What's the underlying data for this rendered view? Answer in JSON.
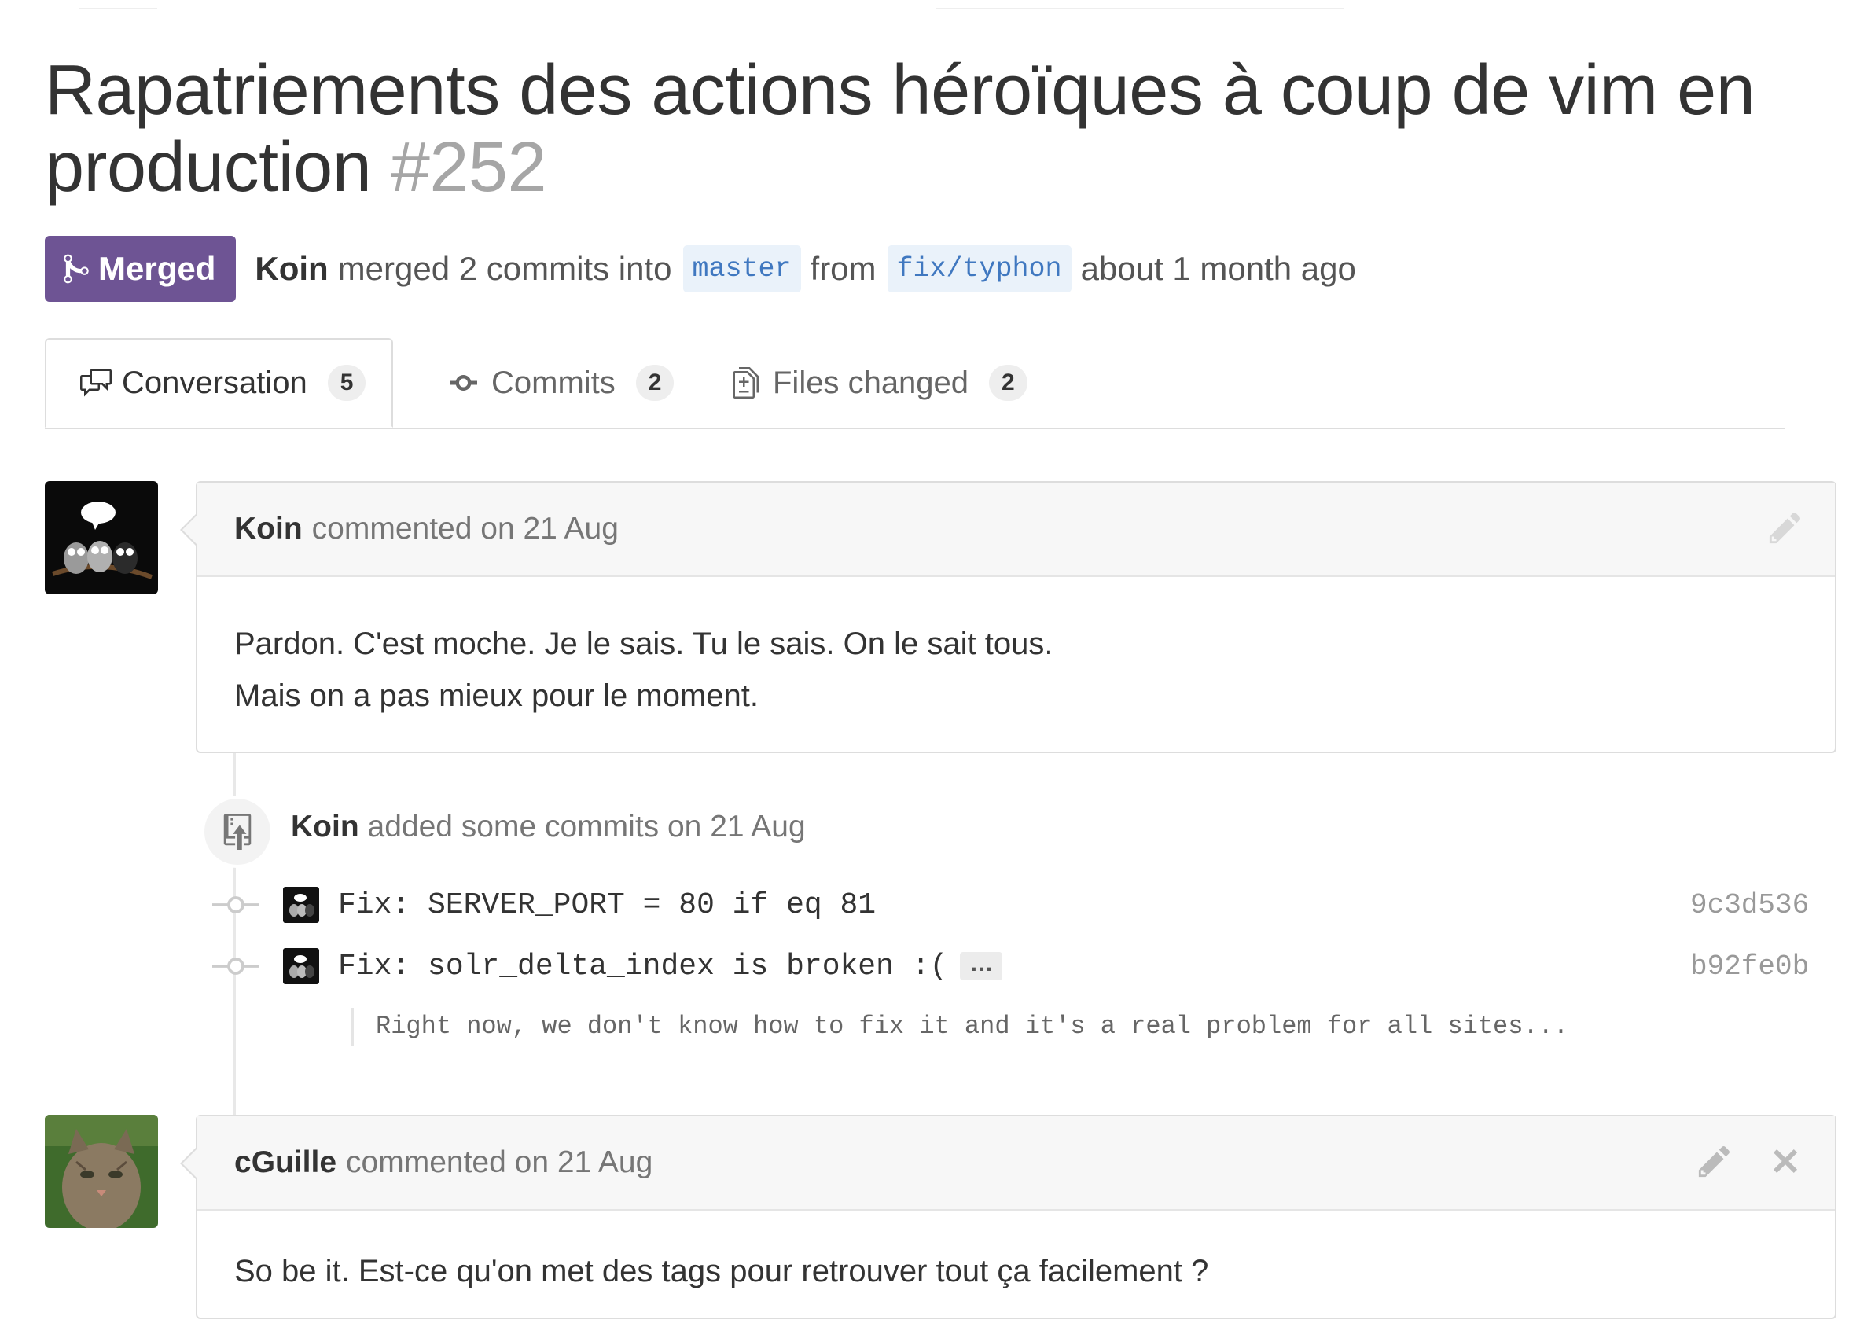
{
  "pr": {
    "title": "Rapatriements des actions héroïques à coup de vim en production",
    "number": "#252",
    "state_label": "Merged",
    "author": "Koin",
    "merged_text": "merged 2 commits into",
    "base_branch": "master",
    "from_text": "from",
    "head_branch": "fix/typhon",
    "time_ago": "about 1 month ago"
  },
  "tabs": [
    {
      "label": "Conversation",
      "count": "5",
      "icon": "comment-discussion-icon"
    },
    {
      "label": "Commits",
      "count": "2",
      "icon": "git-commit-icon"
    },
    {
      "label": "Files changed",
      "count": "2",
      "icon": "file-diff-icon"
    }
  ],
  "comments": [
    {
      "author": "Koin",
      "action": "commented on 21 Aug",
      "lines": [
        "Pardon. C'est moche. Je le sais. Tu le sais. On le sait tous.",
        "Mais on a pas mieux pour le moment."
      ]
    },
    {
      "author": "cGuille",
      "action": "commented on 21 Aug",
      "lines": [
        "So be it. Est-ce qu'on met des tags pour retrouver tout ça facilement ?"
      ]
    }
  ],
  "commit_event": {
    "author": "Koin",
    "action": "added some commits on 21 Aug",
    "commits": [
      {
        "message": "Fix: SERVER_PORT = 80 if eq 81",
        "sha": "9c3d536"
      },
      {
        "message": "Fix: solr_delta_index is broken :(",
        "sha": "b92fe0b",
        "ellipsis": "…"
      }
    ],
    "description": "Right now, we don't know how to fix it and it's a real problem for all sites..."
  },
  "colors": {
    "merged": "#6e5494",
    "branch_bg": "#eaf2fa",
    "branch_text": "#4078c0"
  }
}
